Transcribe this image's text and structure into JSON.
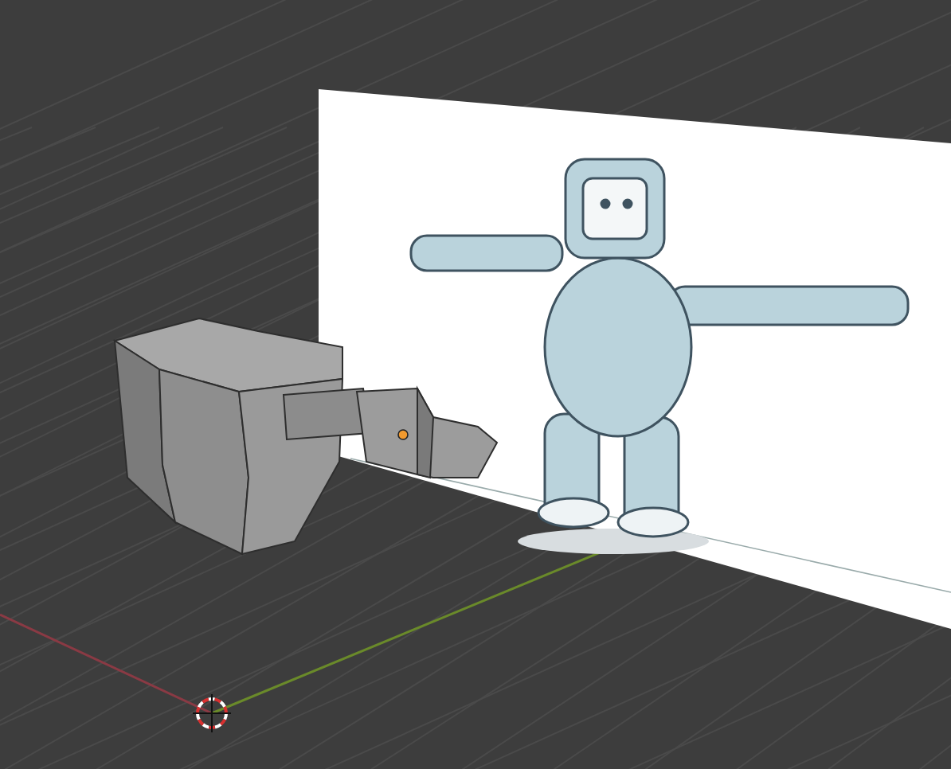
{
  "scene": {
    "objects": [
      {
        "kind": "head",
        "selected": false
      },
      {
        "kind": "arm",
        "selected": true
      }
    ]
  }
}
